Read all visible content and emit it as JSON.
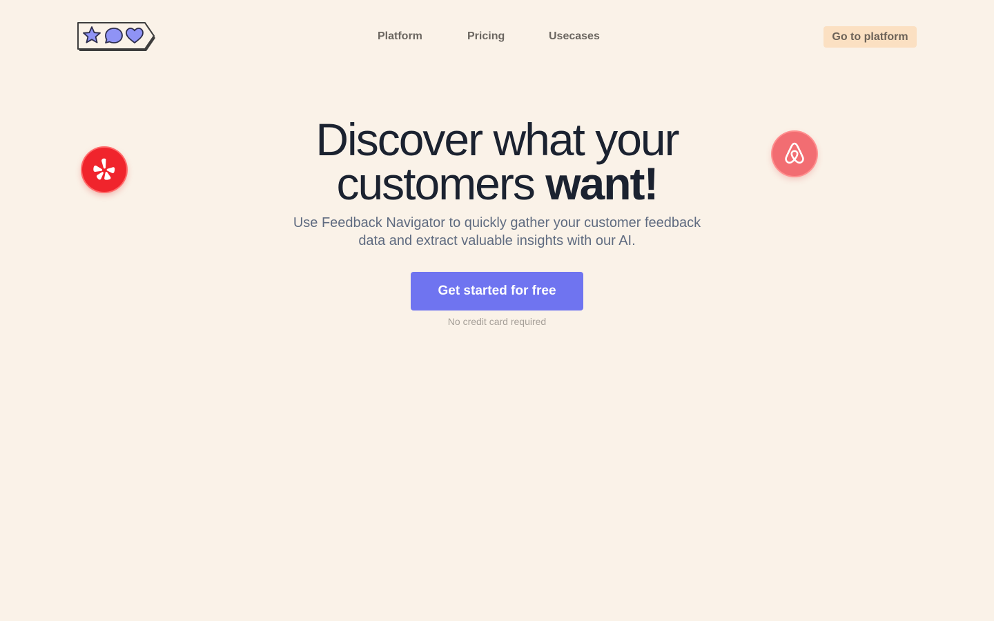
{
  "nav": {
    "items": [
      {
        "label": "Platform"
      },
      {
        "label": "Pricing"
      },
      {
        "label": "Usecases"
      }
    ],
    "cta_label": "Go to platform"
  },
  "logo": {
    "icons": [
      "star-icon",
      "speech-bubble-icon",
      "heart-icon"
    ]
  },
  "badges": [
    {
      "icon": "yelp-logo-icon",
      "color": "#f0242c"
    },
    {
      "icon": "airbnb-logo-icon",
      "color": "#f26d72"
    }
  ],
  "hero": {
    "title_line1": "Discover what your",
    "title_line2_prefix": "customers ",
    "title_line2_strong": "want!",
    "subtitle": "Use Feedback Navigator to quickly gather your customer feedback data and extract valuable insights with our AI.",
    "cta_label": "Get started for free",
    "note": "No credit card required"
  },
  "colors": {
    "background": "#faf2e8",
    "accent": "#6f74f0",
    "logo_fill": "#8f93f5",
    "nav_cta_bg": "#fbe0c2"
  }
}
